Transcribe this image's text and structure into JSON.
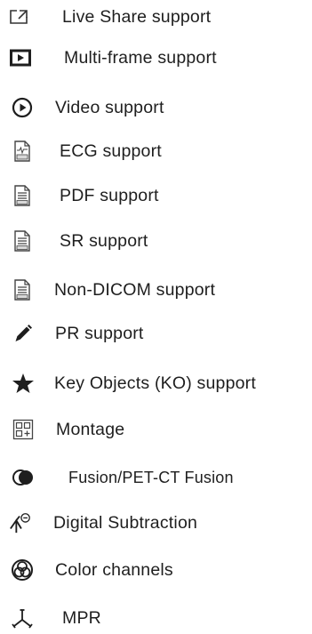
{
  "features": {
    "items": [
      {
        "label": "Live Share support",
        "icon": "external-link-icon"
      },
      {
        "label": "Multi-frame support",
        "icon": "multiframe-play-icon"
      },
      {
        "label": "Video support",
        "icon": "play-circle-icon"
      },
      {
        "label": "ECG support",
        "icon": "ecg-document-icon"
      },
      {
        "label": "PDF support",
        "icon": "pdf-document-icon"
      },
      {
        "label": "SR support",
        "icon": "sr-document-icon"
      },
      {
        "label": "Non-DICOM support",
        "icon": "non-dicom-document-icon"
      },
      {
        "label": "PR support",
        "icon": "pencil-icon"
      },
      {
        "label": "Key Objects (KO) support",
        "icon": "star-icon"
      },
      {
        "label": "Montage",
        "icon": "montage-grid-icon"
      },
      {
        "label": "Fusion/PET-CT Fusion",
        "icon": "fusion-icon"
      },
      {
        "label": "Digital Subtraction",
        "icon": "subtraction-icon"
      },
      {
        "label": "Color channels",
        "icon": "color-channels-icon"
      },
      {
        "label": "MPR",
        "icon": "mpr-axes-icon"
      }
    ]
  }
}
